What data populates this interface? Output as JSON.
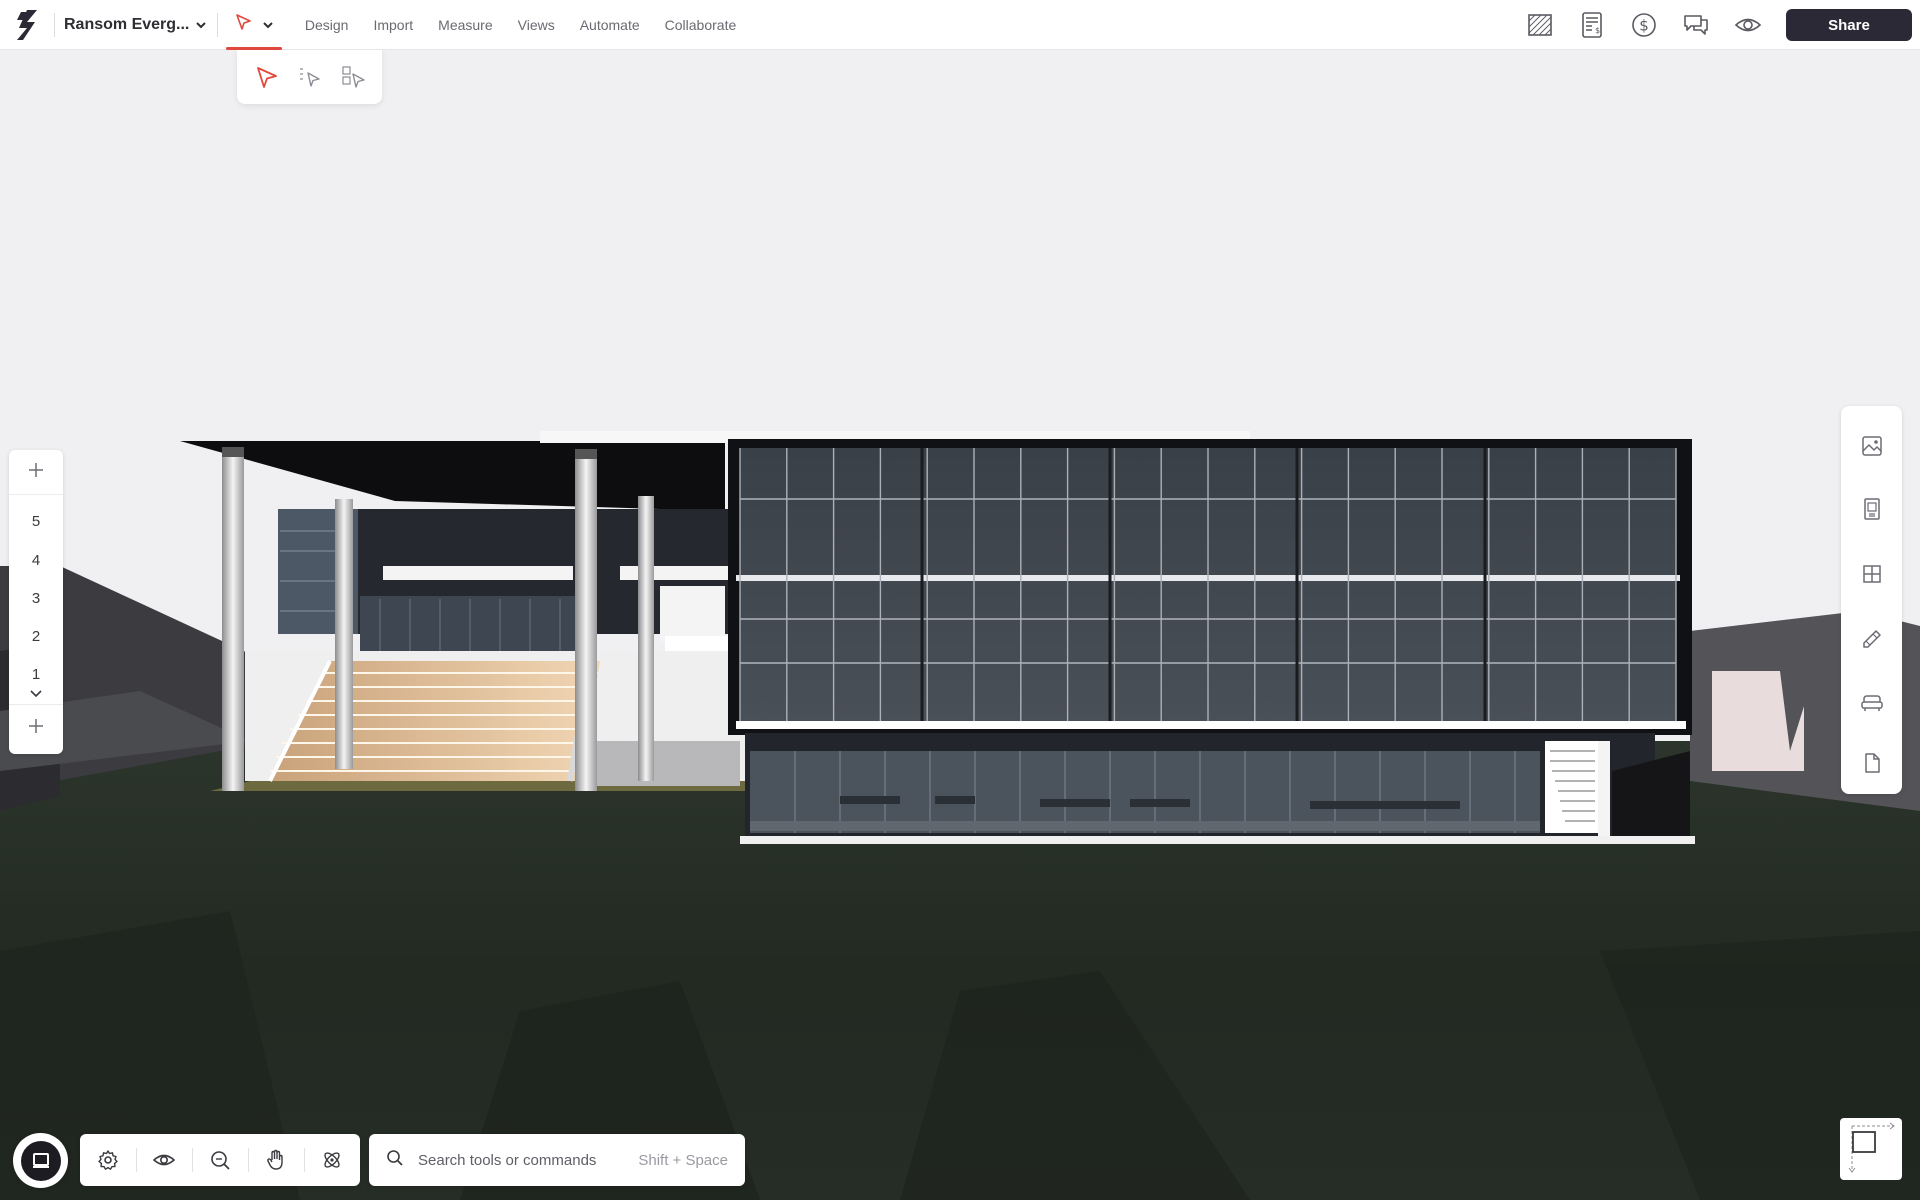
{
  "app": {
    "project_name": "Ransom Everg...",
    "colors": {
      "accent": "#e0483e",
      "dark": "#2a2935",
      "ground": "#232a23"
    }
  },
  "header": {
    "logo_icon": "app-logo-icon",
    "selection_tool_icon": "cursor-arrow-icon",
    "menu": [
      {
        "label": "Design"
      },
      {
        "label": "Import"
      },
      {
        "label": "Measure"
      },
      {
        "label": "Views"
      },
      {
        "label": "Automate"
      },
      {
        "label": "Collaborate"
      }
    ],
    "right_icons": [
      "floor-plan-icon",
      "spreadsheet-cost-icon",
      "dollar-icon",
      "comments-icon",
      "eye-icon"
    ],
    "share_label": "Share"
  },
  "selection_dropdown": {
    "options": [
      "select-cursor-icon",
      "multi-select-cursor-icon",
      "box-select-cursor-icon"
    ],
    "active": "select-cursor-icon"
  },
  "levels": {
    "items": [
      {
        "label": "5"
      },
      {
        "label": "4"
      },
      {
        "label": "3"
      },
      {
        "label": "2"
      },
      {
        "label": "1"
      }
    ]
  },
  "right_panel": {
    "icons": [
      "image-render-icon",
      "elevator-icon",
      "window-grid-icon",
      "pencil-ruler-icon",
      "sofa-icon",
      "document-icon"
    ]
  },
  "bottom_toolbar": {
    "icons": [
      "settings-gear-icon",
      "eye-visibility-icon",
      "zoom-fit-icon",
      "hand-pan-icon",
      "orbit-icon"
    ]
  },
  "search": {
    "placeholder": "Search tools or commands",
    "shortcut": "Shift + Space"
  }
}
